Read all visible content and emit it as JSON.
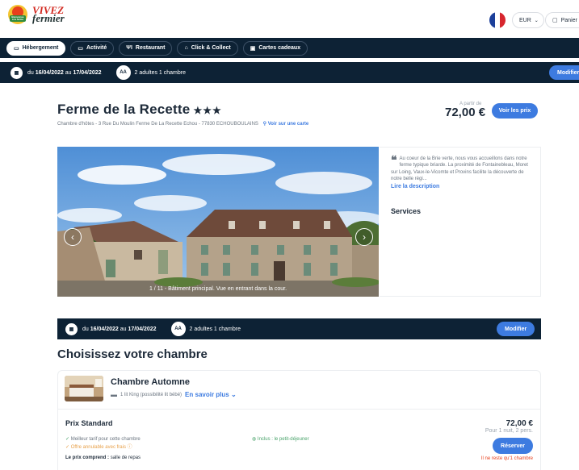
{
  "brand": {
    "line1": "VIVEZ",
    "line2": "fermier",
    "badge": "Bienvenue à la ferme"
  },
  "header": {
    "currency": "EUR",
    "cart": "Panier"
  },
  "nav": {
    "tabs": [
      {
        "label": "Hébergement",
        "icon": "bed-icon"
      },
      {
        "label": "Activité",
        "icon": "ticket-icon"
      },
      {
        "label": "Restaurant",
        "icon": "cutlery-icon"
      },
      {
        "label": "Click & Collect",
        "icon": "bag-icon"
      },
      {
        "label": "Cartes cadeaux",
        "icon": "gift-icon"
      }
    ]
  },
  "search": {
    "du": "du",
    "start": "16/04/2022",
    "au": "au",
    "end": "17/04/2022",
    "avatar": "AA",
    "guests": "2 adultes 1 chambre",
    "modify": "Modifier"
  },
  "property": {
    "name": "Ferme de la Recette",
    "stars": "★★★",
    "address": "Chambre d'hôtes - 3 Rue Du Moulin Ferme De La Recette Echou - 77830 ECHOUBOULAINS",
    "map_link": "Voir sur une carte",
    "from_label": "A partir de",
    "price": "72,00 €",
    "see_prices": "Voir les prix"
  },
  "gallery": {
    "caption": "1 / 11 - Bâtiment principal. Vue en entrant dans la cour."
  },
  "description": {
    "text": "Au coeur de la Brie verte, nous vous accueillons dans notre ferme typique briarde. La proximité de Fontainebleau, Moret sur Loing, Vaux-le-Vicomte et Provins facilite la découverte de notre belle régi...",
    "read_more": "Lire la description",
    "services": "Services"
  },
  "rooms": {
    "heading": "Choisissez votre chambre",
    "room_name": "Chambre Automne",
    "bed": "1 lit King (possibilité lit bébé)",
    "more": "En savoir plus",
    "rate_name": "Prix Standard",
    "best_rate": "Meilleur tarif pour cette chambre",
    "cancel": "Offre annulable avec frais",
    "included": "Inclus : le petit-déjeuner",
    "comprend_label": "Le prix comprend :",
    "comprend_value": "salle de repas",
    "rate_price": "72,00 €",
    "per": "Pour 1 nuit, 2 pers.",
    "reserve": "Réserver",
    "remaining": "Il ne reste qu'1 chambre"
  }
}
